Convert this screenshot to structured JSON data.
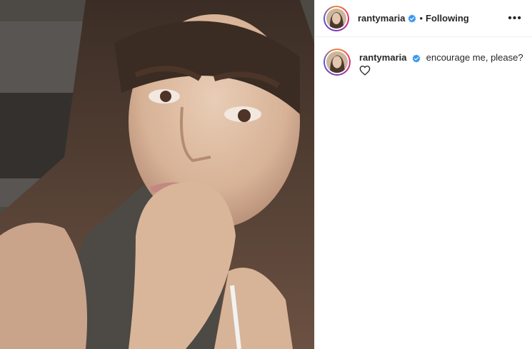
{
  "post": {
    "header": {
      "username": "rantymaria",
      "separator": "•",
      "follow_status": "Following",
      "more_label": "•••"
    },
    "caption": {
      "username": "rantymaria",
      "text": "encourage me, please?"
    },
    "icons": {
      "verified": "verified-badge-icon",
      "like": "heart-outline-icon",
      "more": "more-options-icon"
    },
    "colors": {
      "verified": "#3897f0",
      "text": "#262626",
      "divider": "#efefef"
    }
  }
}
